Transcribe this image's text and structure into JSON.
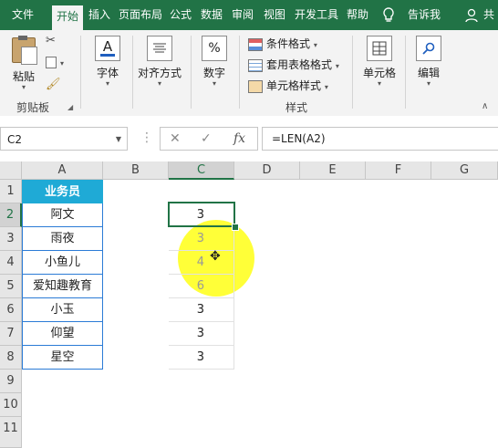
{
  "tabs": [
    "文件",
    "开始",
    "插入",
    "页面布局",
    "公式",
    "数据",
    "审阅",
    "视图",
    "开发工具",
    "帮助"
  ],
  "active_tab": "开始",
  "tellme": "告诉我",
  "share": "共",
  "ribbon": {
    "paste": "粘贴",
    "clipboard": "剪贴板",
    "font": "字体",
    "align": "对齐方式",
    "number": "数字",
    "cond_format": "条件格式",
    "table_format": "套用表格格式",
    "cell_style": "单元格样式",
    "styles": "样式",
    "cells": "单元格",
    "editing": "编辑"
  },
  "namebox": "C2",
  "formula": "=LEN(A2)",
  "columns": [
    "A",
    "B",
    "C",
    "D",
    "E",
    "F",
    "G"
  ],
  "rows": [
    "1",
    "2",
    "3",
    "4",
    "5",
    "6",
    "7",
    "8",
    "9",
    "10",
    "11"
  ],
  "colA": [
    "业务员",
    "阿文",
    "雨夜",
    "小鱼儿",
    "爱知趣教育",
    "小玉",
    "仰望",
    "星空"
  ],
  "colC": [
    "",
    "3",
    "3",
    "4",
    "6",
    "3",
    "3",
    "3"
  ],
  "colors": {
    "accent": "#217346",
    "header_fill": "#1faad6",
    "highlight": "#ffff00"
  }
}
